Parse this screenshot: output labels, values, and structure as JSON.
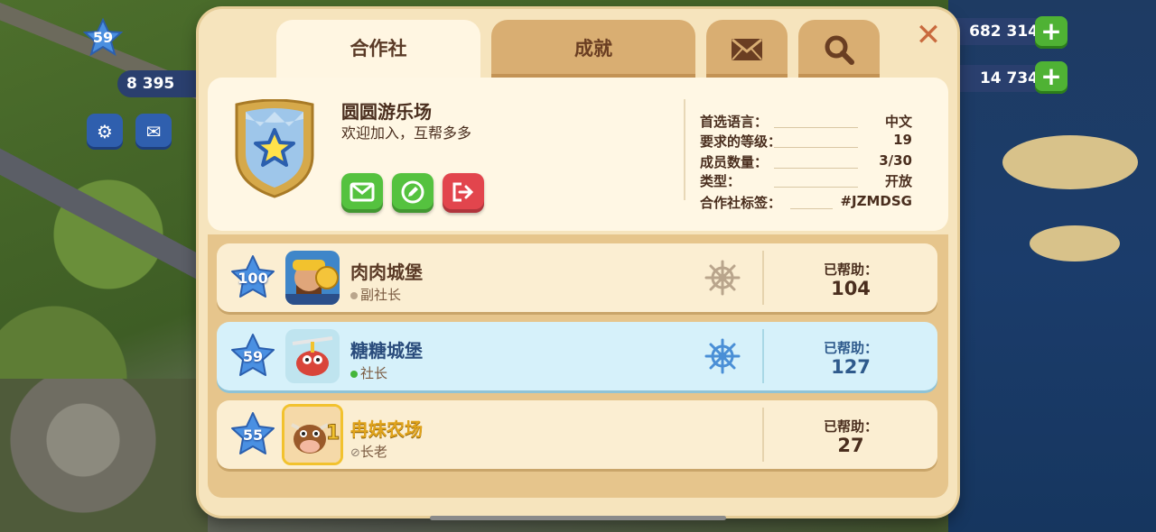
{
  "hud": {
    "level": "59",
    "coins_value": "682 314",
    "gems_value": "14 734",
    "population": "8 395"
  },
  "tabs": {
    "club": "合作社",
    "achievements": "成就",
    "mail_icon": "envelope-icon",
    "search_icon": "search-icon"
  },
  "club": {
    "name": "圆圆游乐场",
    "description": "欢迎加入，互帮多多",
    "info": [
      {
        "key": "首选语言：",
        "value": "中文"
      },
      {
        "key": "要求的等级：",
        "value": "19"
      },
      {
        "key": "成员数量：",
        "value": "3/30"
      },
      {
        "key": "类型：",
        "value": "开放"
      },
      {
        "key": "合作社标签：",
        "value": "#JZMDSG"
      }
    ]
  },
  "members": [
    {
      "level": "100",
      "name": "肉肉城堡",
      "role": "副社长",
      "help_label": "已帮助：",
      "helped": "104",
      "status_color": "#b9a58c"
    },
    {
      "level": "59",
      "name": "糖糖城堡",
      "role": "社长",
      "help_label": "已帮助：",
      "helped": "127",
      "status_color": "#44b53a"
    },
    {
      "level": "55",
      "name": "冉妹农场",
      "role": "长老",
      "help_label": "已帮助：",
      "helped": "27",
      "status_color": "#8a7a6a"
    }
  ],
  "colors": {
    "panel_bg": "#f6e4bd",
    "tab_inactive": "#d9ae72",
    "highlight_row": "#d6f1fa",
    "button_green": "#55c23f",
    "button_red": "#e2454d",
    "star_blue": "#4a90e2"
  }
}
